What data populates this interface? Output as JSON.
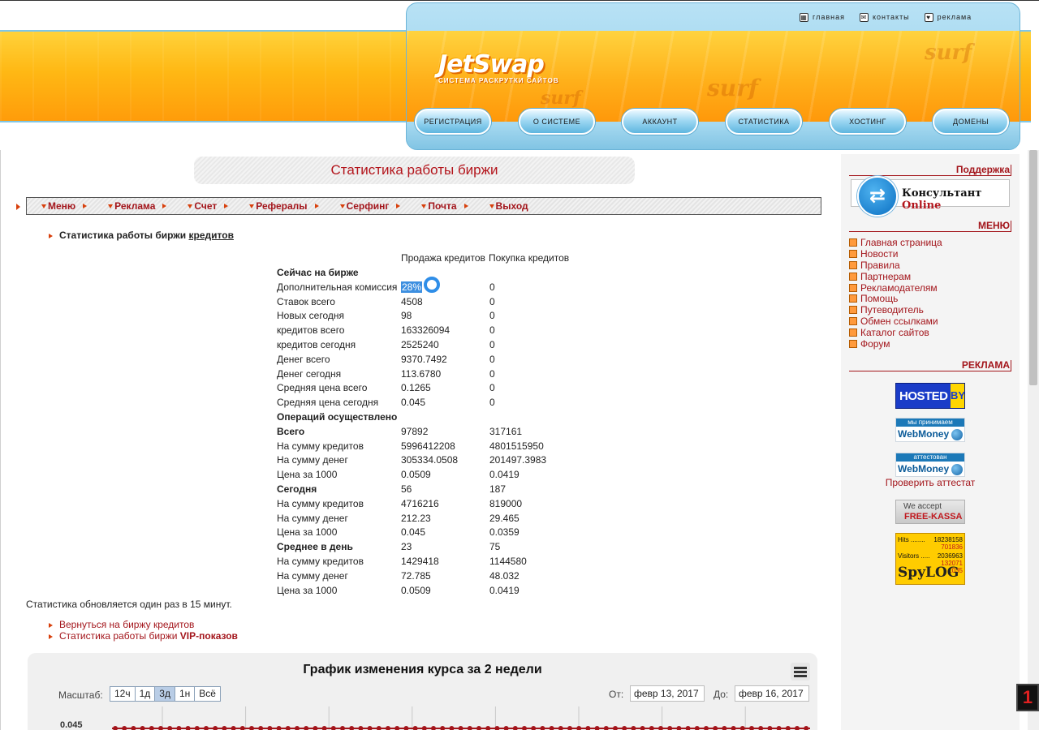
{
  "header": {
    "top_links": [
      {
        "label": "главная",
        "icon": "building-icon"
      },
      {
        "label": "контакты",
        "icon": "envelope-icon"
      },
      {
        "label": "реклама",
        "icon": "shield-icon"
      }
    ],
    "logo_title": "JetSwap",
    "logo_subtitle": "СИСТЕМА РАСКРУТКИ САЙТОВ",
    "decor_word": "surf",
    "nav": [
      "РЕГИСТРАЦИЯ",
      "О СИСТЕМЕ",
      "АККАУНТ",
      "СТАТИСТИКА",
      "ХОСТИНГ",
      "ДОМЕНЫ"
    ]
  },
  "page": {
    "title": "Статистика работы биржи",
    "menu": [
      "Меню",
      "Реклама",
      "Счет",
      "Рефералы",
      "Серфинг",
      "Почта",
      "Выход"
    ],
    "heading_prefix": "Статистика работы биржи",
    "heading_link": "кредитов",
    "col_sell": "Продажа кредитов",
    "col_buy": "Покупка кредитов",
    "rows": [
      {
        "label": "Сейчас на бирже",
        "v1": "",
        "v2": "",
        "section": true
      },
      {
        "label": "Дополнительная комиссия",
        "v1": "28%",
        "v2": "0",
        "highlight": true
      },
      {
        "label": "Ставок всего",
        "v1": "4508",
        "v2": "0"
      },
      {
        "label": "Новых сегодня",
        "v1": "98",
        "v2": "0"
      },
      {
        "label": "кредитов всего",
        "v1": "163326094",
        "v2": "0"
      },
      {
        "label": "кредитов сегодня",
        "v1": "2525240",
        "v2": "0"
      },
      {
        "label": "Денег всего",
        "v1": "9370.7492",
        "v2": "0"
      },
      {
        "label": "Денег сегодня",
        "v1": "113.6780",
        "v2": "0"
      },
      {
        "label": "Средняя цена всего",
        "v1": "0.1265",
        "v2": "0"
      },
      {
        "label": "Средняя цена сегодня",
        "v1": "0.045",
        "v2": "0"
      },
      {
        "label": "Операций осуществлено",
        "v1": "",
        "v2": "",
        "section": true
      },
      {
        "label": "Всего",
        "v1": "97892",
        "v2": "317161",
        "section": true
      },
      {
        "label": "На сумму кредитов",
        "v1": "5996412208",
        "v2": "4801515950"
      },
      {
        "label": "На сумму денег",
        "v1": "305334.0508",
        "v2": "201497.3983"
      },
      {
        "label": "Цена за 1000",
        "v1": "0.0509",
        "v2": "0.0419"
      },
      {
        "label": "Сегодня",
        "v1": "56",
        "v2": "187",
        "section": true
      },
      {
        "label": "На сумму кредитов",
        "v1": "4716216",
        "v2": "819000"
      },
      {
        "label": "На сумму денег",
        "v1": "212.23",
        "v2": "29.465"
      },
      {
        "label": "Цена за 1000",
        "v1": "0.045",
        "v2": "0.0359"
      },
      {
        "label": "Среднее в день",
        "v1": "23",
        "v2": "75",
        "section": true
      },
      {
        "label": "На сумму кредитов",
        "v1": "1429418",
        "v2": "1144580"
      },
      {
        "label": "На сумму денег",
        "v1": "72.785",
        "v2": "48.032"
      },
      {
        "label": "Цена за 1000",
        "v1": "0.0509",
        "v2": "0.0419"
      }
    ],
    "update_note": "Статистика обновляется один раз в 15 минут.",
    "back_link_1": "Вернуться на биржу кредитов",
    "back_link_2_prefix": "Статистика работы биржи",
    "back_link_2_bold": "VIP-показов"
  },
  "chart": {
    "title": "График изменения курса за 2 недели",
    "zoom_label": "Масштаб:",
    "zoom_buttons": [
      "12ч",
      "1д",
      "3д",
      "1н",
      "Всё"
    ],
    "zoom_active": 2,
    "from_label": "От:",
    "from_date": "февр 13, 2017",
    "to_label": "До:",
    "to_date": "февр 16, 2017",
    "y_tick": "0.045",
    "line_color": "#a3151b"
  },
  "sidebar": {
    "support_title": "Поддержка",
    "consultant_label": "Консультант",
    "consultant_online": "Online",
    "menu_title": "МЕНЮ",
    "menu_items": [
      "Главная страница",
      "Новости",
      "Правила",
      "Партнерам",
      "Рекламодателям",
      "Помощь",
      "Путеводитель",
      "Обмен ссылками",
      "Каталог сайтов",
      "Форум"
    ],
    "ads_title": "РЕКЛАМА",
    "hosted_label": "HOSTED",
    "hosted_by": "BY",
    "wm_accept_caption": "мы принимаем",
    "wm_attest_caption": "аттестован",
    "wm_brand": "WebMoney",
    "check_attestat": "Проверить аттестат",
    "freekassa_line1": "We accept",
    "freekassa_line2": "FREE-KASSA",
    "spylog": {
      "hits_label": "Hits ........",
      "hits": "18238158",
      "hits_today": "701836",
      "visitors_label": "Visitors .....",
      "visitors": "2036963",
      "visitors_today": "132071",
      "online": "1035",
      "logo": "SpyLOG"
    }
  },
  "counter_badge": "1",
  "colors": {
    "accent_red": "#a3151b",
    "arrow_orange": "#d8400c",
    "header_orange": "#ffb814",
    "header_blue": "#8ccbe8"
  }
}
